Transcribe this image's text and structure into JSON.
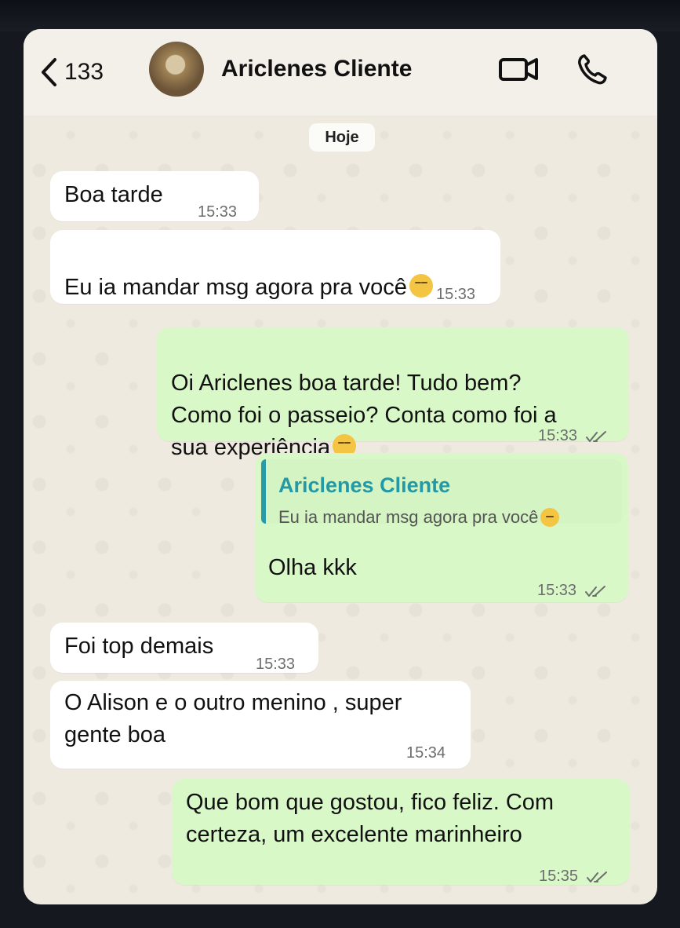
{
  "header": {
    "back_count": "133",
    "contact_name": "Ariclenes Cliente"
  },
  "chat": {
    "date_label": "Hoje",
    "messages": [
      {
        "direction": "incoming",
        "text": "Boa tarde",
        "time": "15:33"
      },
      {
        "direction": "incoming",
        "text": "Eu ia mandar msg agora pra você",
        "time": "15:33"
      },
      {
        "direction": "outgoing",
        "text": "Oi Ariclenes boa tarde! Tudo bem?\nComo foi o passeio? Conta como foi a\nsua experiência",
        "time": "15:33"
      },
      {
        "direction": "outgoing",
        "quote": {
          "author": "Ariclenes Cliente",
          "text": "Eu ia mandar msg agora pra você"
        },
        "text": "Olha kkk",
        "time": "15:33"
      },
      {
        "direction": "incoming",
        "text": "Foi top demais",
        "time": "15:33"
      },
      {
        "direction": "incoming",
        "text": "O Alison e o outro menino , super\ngente boa",
        "time": "15:34"
      },
      {
        "direction": "outgoing",
        "text": "Que bom que gostou, fico feliz. Com\ncerteza, um excelente marinheiro",
        "time": "15:35"
      }
    ]
  },
  "icons": {
    "back": "chevron-left-icon",
    "video": "video-camera-icon",
    "call": "phone-icon",
    "read_receipt": "double-check-icon",
    "emoji": "smiling-face-emoji"
  },
  "colors": {
    "incoming_bubble": "#ffffff",
    "outgoing_bubble": "#d8f8c8",
    "quote_accent": "#279ba8",
    "background": "#efeae0"
  }
}
